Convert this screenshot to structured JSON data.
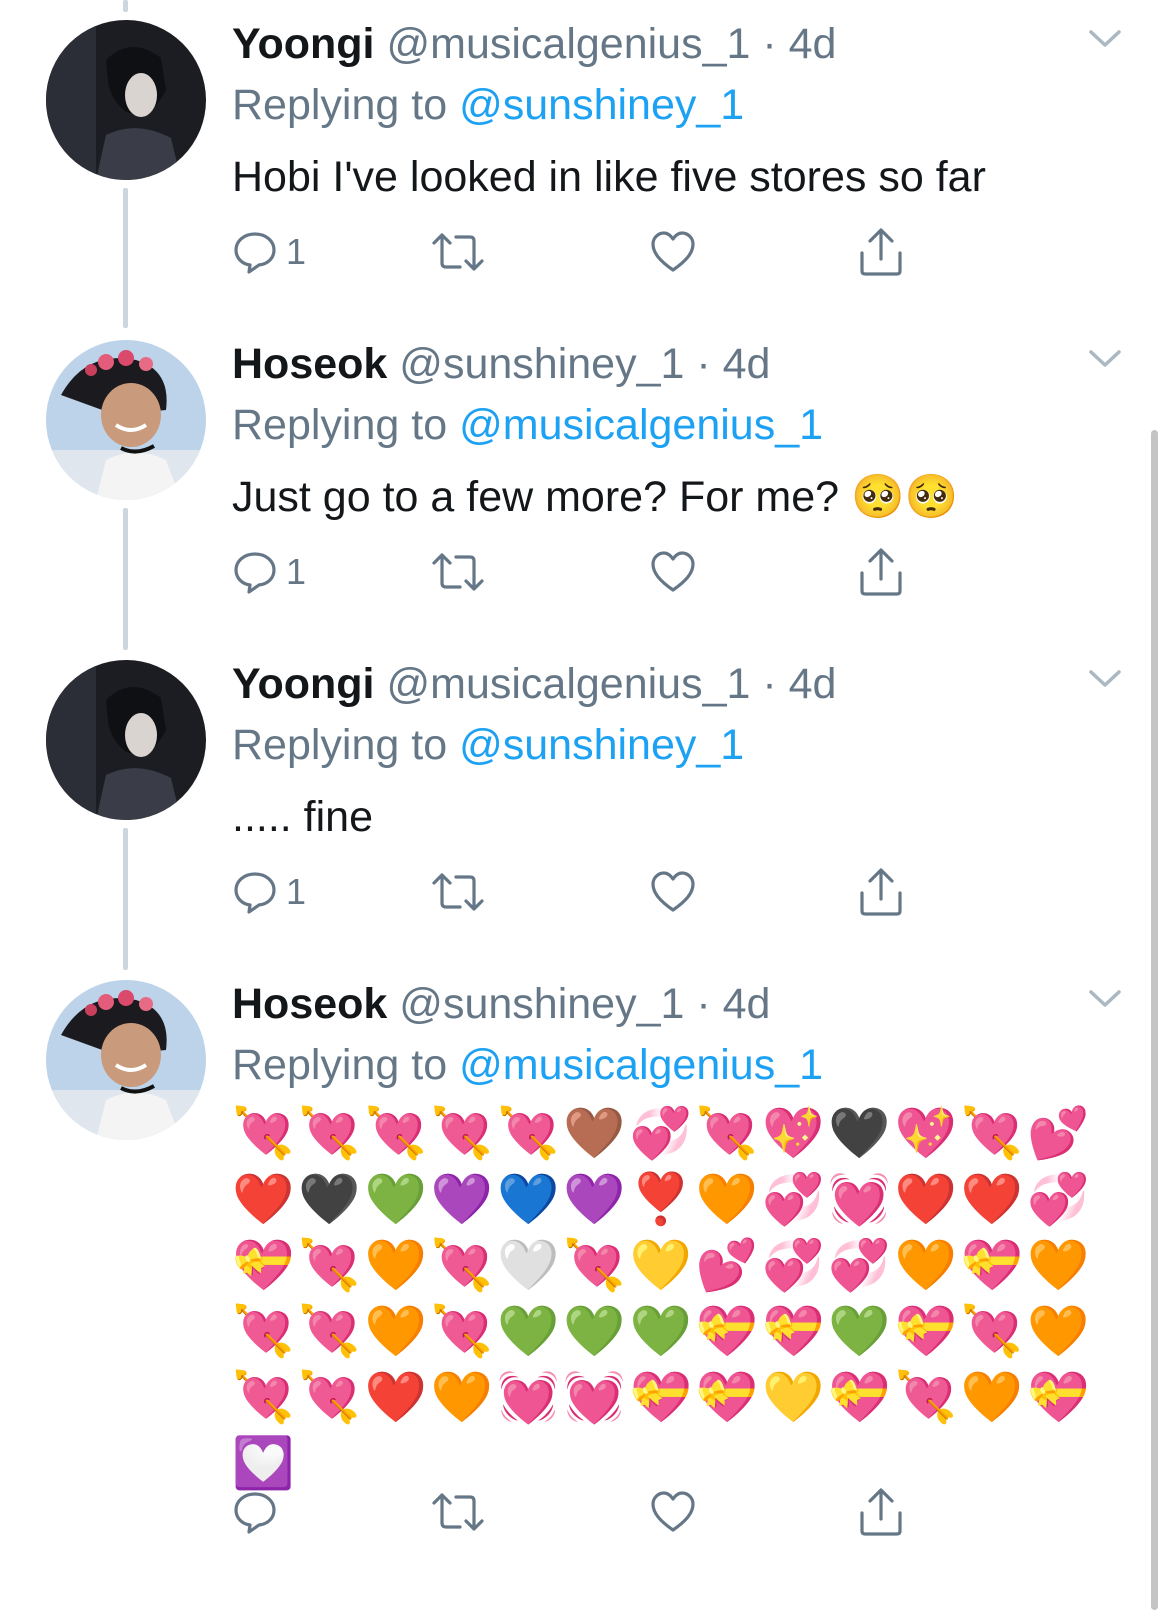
{
  "tweets": [
    {
      "name": "Yoongi",
      "handle": "@musicalgenius_1",
      "time": "4d",
      "replying_prefix": "Replying to",
      "replying_to": "@sunshiney_1",
      "text": "Hobi I've looked in like five stores so far",
      "reply_count": "1"
    },
    {
      "name": "Hoseok",
      "handle": "@sunshiney_1",
      "time": "4d",
      "replying_prefix": "Replying to",
      "replying_to": "@musicalgenius_1",
      "text": "Just go to a few more? For me? 🥺🥺",
      "reply_count": "1"
    },
    {
      "name": "Yoongi",
      "handle": "@musicalgenius_1",
      "time": "4d",
      "replying_prefix": "Replying to",
      "replying_to": "@sunshiney_1",
      "text": "..... fine",
      "reply_count": "1"
    },
    {
      "name": "Hoseok",
      "handle": "@sunshiney_1",
      "time": "4d",
      "replying_prefix": "Replying to",
      "replying_to": "@musicalgenius_1",
      "emoji_rows": [
        "💘💘💘💘💘🤎💞💘💖🖤💖💘💕",
        "❤️🖤💚💜💙💜❣️🧡💞💓❤️❤️💞",
        "💝💘🧡💘🤍💘💛💕💞💞🧡💝🧡",
        "💘💘🧡💘💚💚💚💝💝💚💝💘🧡",
        "💘💘❤️🧡💓💓💝💝💛💝💘🧡💝",
        "💟"
      ],
      "reply_count": ""
    }
  ],
  "colors": {
    "name": "#14171a",
    "secondary": "#657786",
    "link": "#1da1f2",
    "thread_line": "#ccd6dd"
  },
  "icons": [
    "reply-icon",
    "retweet-icon",
    "like-icon",
    "share-icon",
    "chevron-down-icon"
  ]
}
